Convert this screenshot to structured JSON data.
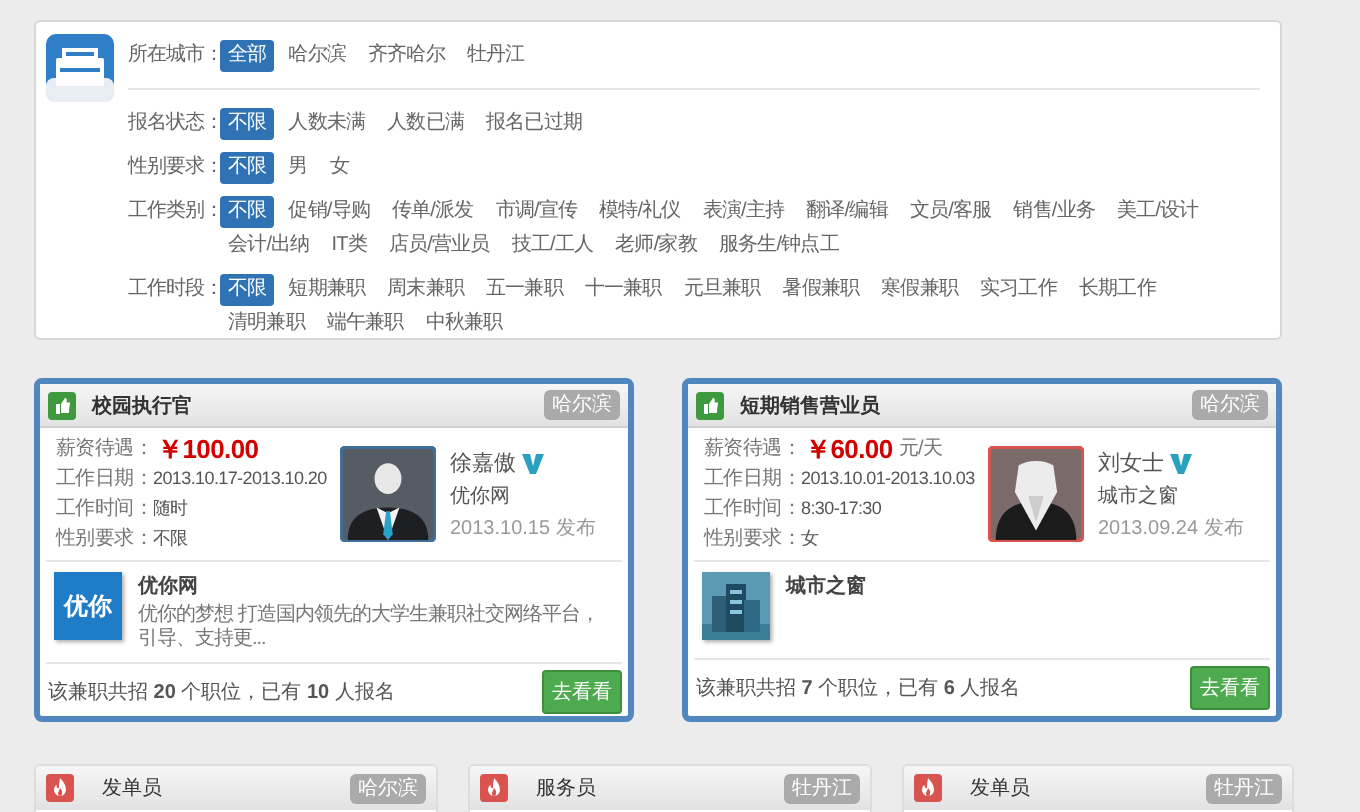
{
  "filters": [
    {
      "label": "所在城市：",
      "options": [
        {
          "label": "全部",
          "selected": true
        },
        {
          "label": "哈尔滨",
          "selected": false
        },
        {
          "label": "齐齐哈尔",
          "selected": false
        },
        {
          "label": "牡丹江",
          "selected": false
        }
      ]
    },
    {
      "label": "报名状态：",
      "options": [
        {
          "label": "不限",
          "selected": true
        },
        {
          "label": "人数未满",
          "selected": false
        },
        {
          "label": "人数已满",
          "selected": false
        },
        {
          "label": "报名已过期",
          "selected": false
        }
      ]
    },
    {
      "label": "性别要求：",
      "options": [
        {
          "label": "不限",
          "selected": true
        },
        {
          "label": "男",
          "selected": false
        },
        {
          "label": "女",
          "selected": false
        }
      ]
    },
    {
      "label": "工作类别：",
      "options": [
        {
          "label": "不限",
          "selected": true
        },
        {
          "label": "促销/导购",
          "selected": false
        },
        {
          "label": "传单/派发",
          "selected": false
        },
        {
          "label": "市调/宣传",
          "selected": false
        },
        {
          "label": "模特/礼仪",
          "selected": false
        },
        {
          "label": "表演/主持",
          "selected": false
        },
        {
          "label": "翻译/编辑",
          "selected": false
        },
        {
          "label": "文员/客服",
          "selected": false
        },
        {
          "label": "销售/业务",
          "selected": false
        },
        {
          "label": "美工/设计",
          "selected": false
        },
        {
          "label": "会计/出纳",
          "selected": false
        },
        {
          "label": "IT类",
          "selected": false
        },
        {
          "label": "店员/营业员",
          "selected": false
        },
        {
          "label": "技工/工人",
          "selected": false
        },
        {
          "label": "老师/家教",
          "selected": false
        },
        {
          "label": "服务生/钟点工",
          "selected": false
        }
      ]
    },
    {
      "label": "工作时段：",
      "options": [
        {
          "label": "不限",
          "selected": true
        },
        {
          "label": "短期兼职",
          "selected": false
        },
        {
          "label": "周末兼职",
          "selected": false
        },
        {
          "label": "五一兼职",
          "selected": false
        },
        {
          "label": "十一兼职",
          "selected": false
        },
        {
          "label": "元旦兼职",
          "selected": false
        },
        {
          "label": "暑假兼职",
          "selected": false
        },
        {
          "label": "寒假兼职",
          "selected": false
        },
        {
          "label": "实习工作",
          "selected": false
        },
        {
          "label": "长期工作",
          "selected": false
        },
        {
          "label": "清明兼职",
          "selected": false
        },
        {
          "label": "端午兼职",
          "selected": false
        },
        {
          "label": "中秋兼职",
          "selected": false
        }
      ]
    }
  ],
  "featured_jobs": [
    {
      "kind": "thumb",
      "title": "校园执行官",
      "city": "哈尔滨",
      "fields": [
        {
          "label": "薪资待遇：",
          "kind": "salary",
          "value": "￥100.00"
        },
        {
          "label": "工作日期：",
          "kind": "text",
          "value": "2013.10.17-2013.10.20"
        },
        {
          "label": "工作时间：",
          "kind": "text",
          "value": "随时"
        },
        {
          "label": "性别要求：",
          "kind": "text",
          "value": "不限"
        }
      ],
      "avatar": {
        "kind": "male"
      },
      "poster": "徐嘉傲",
      "verified": true,
      "poster_company": "优你网",
      "posted": "2013.10.15 发布",
      "company": {
        "logo": {
          "kind": "text",
          "text": "优你"
        },
        "name": "优你网",
        "description": "优你的梦想 打造国内领先的大学生兼职社交网络平台，引导、支持更..."
      },
      "summary": "该兼职共招 **20** 个职位，已有 **10** 人报名",
      "button": "去看看"
    },
    {
      "kind": "thumb",
      "title": "短期销售营业员",
      "city": "哈尔滨",
      "fields": [
        {
          "label": "薪资待遇：",
          "kind": "salary",
          "value": "￥60.00",
          "unit": "元/天"
        },
        {
          "label": "工作日期：",
          "kind": "text",
          "value": "2013.10.01-2013.10.03"
        },
        {
          "label": "工作时间：",
          "kind": "text",
          "value": "8:30-17:30"
        },
        {
          "label": "性别要求：",
          "kind": "text",
          "value": "女"
        }
      ],
      "avatar": {
        "kind": "female"
      },
      "poster": "刘女士",
      "verified": true,
      "poster_company": "城市之窗",
      "posted": "2013.09.24 发布",
      "company": {
        "name": "城市之窗"
      },
      "summary": "该兼职共招 **7** 个职位，已有 **6** 人报名",
      "button": "去看看"
    }
  ],
  "jobs": [
    {
      "kind": "fire",
      "title": "发单员",
      "city": "哈尔滨"
    },
    {
      "kind": "fire",
      "title": "服务员",
      "city": "牡丹江"
    },
    {
      "kind": "fire",
      "title": "发单员",
      "city": "牡丹江"
    }
  ]
}
